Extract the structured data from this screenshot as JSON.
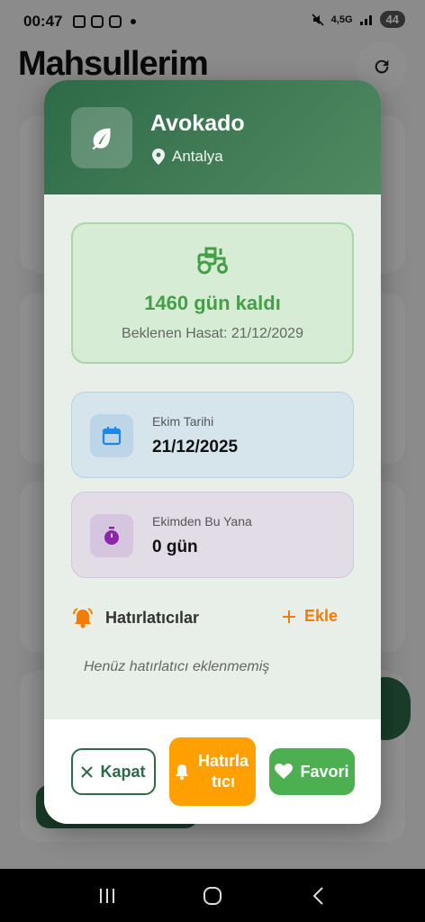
{
  "status_bar": {
    "time": "00:47",
    "network": "4,5G",
    "battery": "44"
  },
  "background": {
    "title": "Mahsullerim"
  },
  "dialog": {
    "crop_name": "Avokado",
    "location": "Antalya",
    "harvest": {
      "days_left": "1460 gün kaldı",
      "expected": "Beklenen Hasat: 21/12/2029"
    },
    "planting": {
      "label": "Ekim Tarihi",
      "value": "21/12/2025"
    },
    "since": {
      "label": "Ekimden Bu Yana",
      "value": "0 gün"
    },
    "reminders": {
      "title": "Hatırlatıcılar",
      "add_label": "Ekle",
      "empty": "Henüz hatırlatıcı eklenmemiş"
    },
    "buttons": {
      "close": "Kapat",
      "reminder": "Hatırlatıcı",
      "favorite": "Favori"
    }
  },
  "colors": {
    "header": "#2f6a48",
    "success": "#43a047",
    "accent": "#f57c00",
    "reminder_button": "#ffa000",
    "favorite_button": "#4caf50"
  }
}
